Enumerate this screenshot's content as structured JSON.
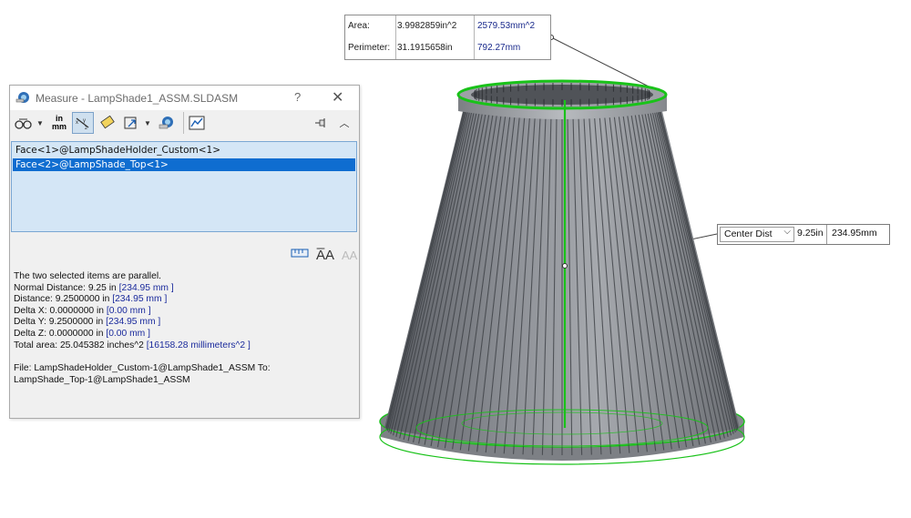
{
  "area_callout": {
    "rows": [
      {
        "label": "Area:",
        "value_in": "3.9982859in^2",
        "value_mm": "2579.53mm^2"
      },
      {
        "label": "Perimeter:",
        "value_in": "31.1915658in",
        "value_mm": "792.27mm"
      }
    ]
  },
  "center_dist_callout": {
    "selected": "Center Dist",
    "value_in": "9.25in",
    "value_mm": "234.95mm"
  },
  "dialog": {
    "title": "Measure - LampShade1_ASSM.SLDASM",
    "help": "?",
    "close": "✕",
    "toolbar": {
      "icons": [
        "arc-circle-measure-icon",
        "units-precision-icon",
        "show-xyz-icon",
        "point-to-point-icon",
        "projection-icon",
        "create-sensor-icon",
        "measure-history-icon",
        "pin-icon",
        "collapse-icon"
      ],
      "units_top": "in",
      "units_bottom": "mm"
    },
    "selections": [
      "Face<1>@LampShadeHolder_Custom<1>",
      "Face<2>@LampShade_Top<1>"
    ],
    "selected_index": 1,
    "results": {
      "parallel_note": "The two selected items are parallel.",
      "lines": [
        {
          "label": "Normal Distance: 9.25 in",
          "metric": "[234.95 mm ]"
        },
        {
          "label": "Distance: 9.2500000 in",
          "metric": "[234.95 mm ]"
        },
        {
          "label": "Delta X: 0.0000000 in",
          "metric": "[0.00 mm ]"
        },
        {
          "label": "Delta Y: 9.2500000 in",
          "metric": "[234.95 mm ]"
        },
        {
          "label": "Delta Z: 0.0000000 in",
          "metric": "[0.00 mm ]"
        },
        {
          "label": "Total area: 25.045382 inches^2",
          "metric": "[16158.28 millimeters^2 ]"
        }
      ],
      "file_line1": "File: LampShadeHolder_Custom-1@LampShade1_ASSM To:",
      "file_line2": "LampShade_Top-1@LampShade1_ASSM"
    }
  },
  "colors": {
    "selection_green": "#19c219",
    "list_bg": "#d4e6f6",
    "list_selected": "#0f6dd0",
    "metric_blue": "#1a2a9c",
    "model_gray": "#8a8d92"
  }
}
